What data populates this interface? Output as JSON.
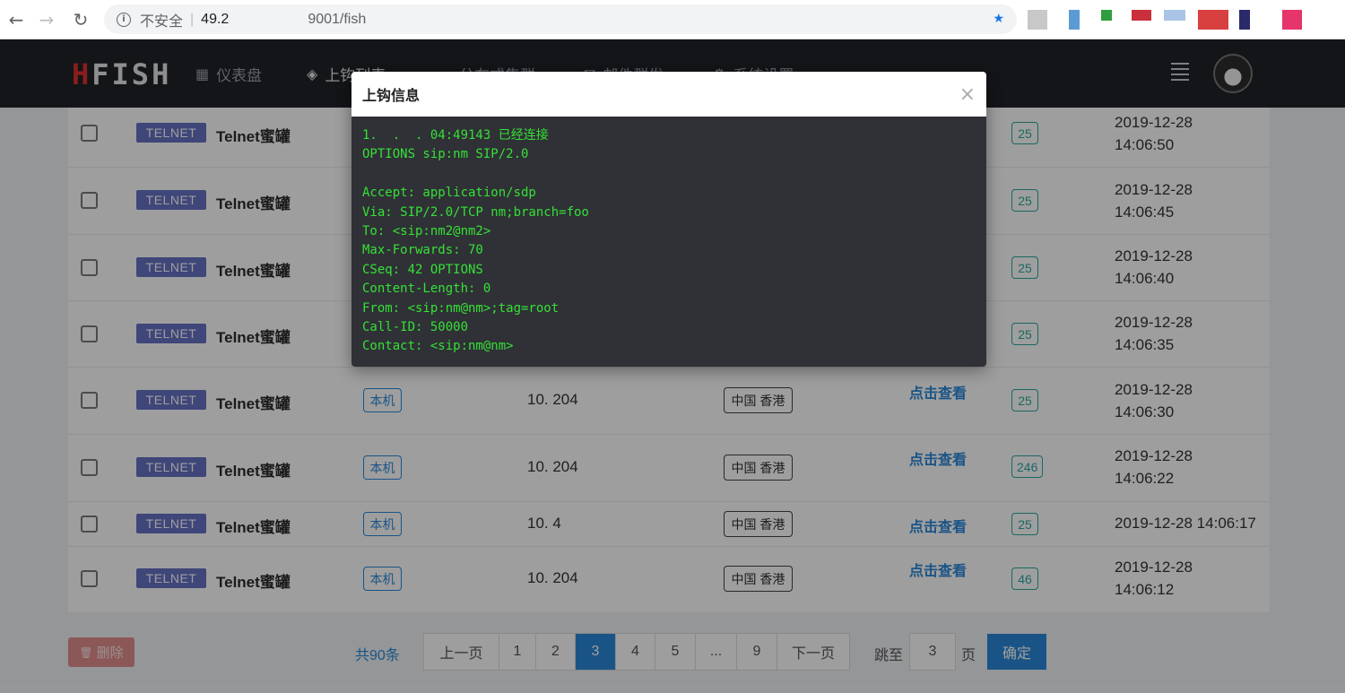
{
  "browser": {
    "insecure_label": "不安全",
    "separator": "|",
    "host_prefix": "49.2",
    "url_path": "9001/fish"
  },
  "app": {
    "logo": {
      "prefix": "H",
      "rest": "FISH"
    },
    "nav": [
      {
        "label": "仪表盘",
        "icon": "dashboard-icon"
      },
      {
        "label": "上钩列表",
        "icon": "fish-icon"
      },
      {
        "label": "分布式集群",
        "icon": "cloud-icon"
      },
      {
        "label": "邮件群发",
        "icon": "mail-icon"
      },
      {
        "label": "系统设置",
        "icon": "gear-icon"
      }
    ]
  },
  "table": {
    "rows": [
      {
        "type": "TELNET",
        "name": "Telnet蜜罐",
        "source": "",
        "ip": "",
        "region": "",
        "view": "",
        "count": "25",
        "time": [
          "2019-12-28",
          "14:06:50"
        ]
      },
      {
        "type": "TELNET",
        "name": "Telnet蜜罐",
        "source": "",
        "ip": "",
        "region": "",
        "view": "",
        "count": "25",
        "time": [
          "2019-12-28",
          "14:06:45"
        ]
      },
      {
        "type": "TELNET",
        "name": "Telnet蜜罐",
        "source": "",
        "ip": "",
        "region": "",
        "view": "",
        "count": "25",
        "time": [
          "2019-12-28",
          "14:06:40"
        ]
      },
      {
        "type": "TELNET",
        "name": "Telnet蜜罐",
        "source": "",
        "ip": "",
        "region": "",
        "view": "",
        "count": "25",
        "time": [
          "2019-12-28",
          "14:06:35"
        ]
      },
      {
        "type": "TELNET",
        "name": "Telnet蜜罐",
        "source": "本机",
        "ip": "10.  204",
        "region": "中国 香港",
        "view": "点击查看",
        "count": "25",
        "time": [
          "2019-12-28",
          "14:06:30"
        ]
      },
      {
        "type": "TELNET",
        "name": "Telnet蜜罐",
        "source": "本机",
        "ip": "10.  204",
        "region": "中国 香港",
        "view": "点击查看",
        "count": "246",
        "time": [
          "2019-12-28",
          "14:06:22"
        ]
      },
      {
        "type": "TELNET",
        "name": "Telnet蜜罐",
        "source": "本机",
        "ip": "10.  4",
        "region": "中国 香港",
        "view": "点击查看",
        "count": "25",
        "time": [
          "2019-12-28 14:06:17",
          ""
        ]
      },
      {
        "type": "TELNET",
        "name": "Telnet蜜罐",
        "source": "本机",
        "ip": "10.  204",
        "region": "中国 香港",
        "view": "点击查看",
        "count": "46",
        "time": [
          "2019-12-28",
          "14:06:12"
        ]
      }
    ]
  },
  "footer": {
    "delete_label": "删除",
    "total": "共90条",
    "prev": "上一页",
    "pages": [
      "1",
      "2",
      "3",
      "4",
      "5",
      "...",
      "9"
    ],
    "current_page": "3",
    "next": "下一页",
    "jump_label": "跳至",
    "jump_value": "3",
    "page_unit": "页",
    "confirm": "确定"
  },
  "modal": {
    "title": "上钩信息",
    "close": "×",
    "lines": [
      "1.  .  . 04:49143 已经连接",
      "OPTIONS sip:nm SIP/2.0",
      "",
      "Accept: application/sdp",
      "Via: SIP/2.0/TCP nm;branch=foo",
      "To: <sip:nm2@nm2>",
      "Max-Forwards: 70",
      "CSeq: 42 OPTIONS",
      "Content-Length: 0",
      "From: <sip:nm@nm>;tag=root",
      "Call-ID: 50000",
      "Contact: <sip:nm@nm>"
    ]
  },
  "colors": {
    "accent": "#2b88d8",
    "teal": "#2aa9a0",
    "terminal_green": "#36e036",
    "header_bg": "#1f2227",
    "badge_bg": "#6771c4"
  }
}
